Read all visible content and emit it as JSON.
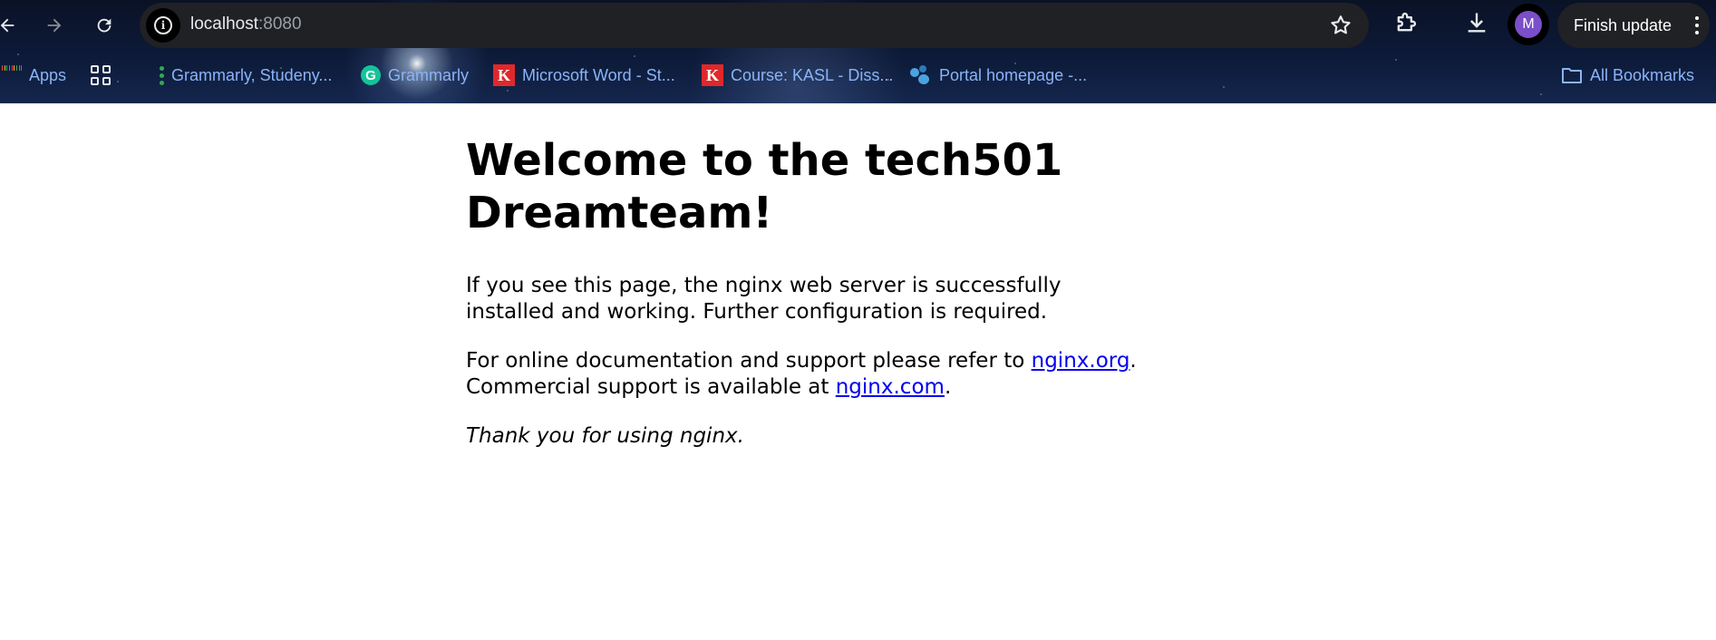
{
  "browser": {
    "url_host": "localhost",
    "url_port": ":8080",
    "profile_initial": "M",
    "finish_update_label": "Finish update",
    "colors": {
      "omnibox_bg": "#202124",
      "bookmark_text": "#8ab4f8",
      "avatar_bg": "#7a4fc9"
    }
  },
  "bookmarks": {
    "apps_label": "Apps",
    "items": [
      {
        "label": "Grammarly, Studeny...",
        "icon": "green-dots-icon"
      },
      {
        "label": "Grammarly",
        "icon": "grammarly-icon"
      },
      {
        "label": "Microsoft Word - St...",
        "icon": "k-logo-icon"
      },
      {
        "label": "Course: KASL - Diss...",
        "icon": "k-logo-icon"
      },
      {
        "label": "Portal homepage -...",
        "icon": "portal-icon"
      }
    ],
    "all_bookmarks_label": "All Bookmarks"
  },
  "page": {
    "heading": "Welcome to the tech501 Dreamteam!",
    "para1": "If you see this page, the nginx web server is successfully installed and working. Further configuration is required.",
    "para2_prefix": "For online documentation and support please refer to ",
    "link_org": "nginx.org",
    "para2_mid": ".",
    "para2_line2": "Commercial support is available at ",
    "link_com": "nginx.com",
    "para2_suffix": ".",
    "thanks": "Thank you for using nginx.",
    "link_color": "#0000ee"
  }
}
